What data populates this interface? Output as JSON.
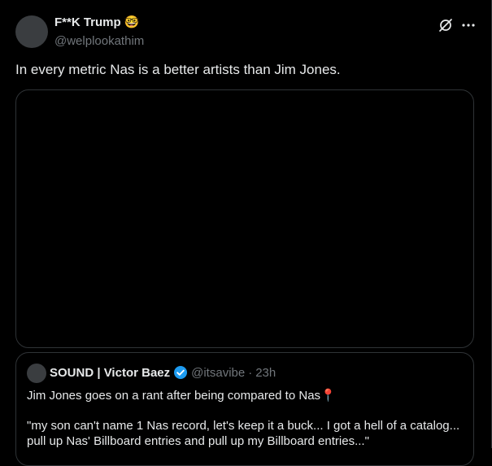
{
  "author": {
    "display_name": "F**K Trump",
    "name_emoji": "🤓",
    "handle": "@welplookathim"
  },
  "tweet": {
    "text": "In every metric Nas is a better artists than Jim Jones."
  },
  "icons": {
    "grok": "grok-icon",
    "more": "more-icon",
    "verified": "verified-badge-icon",
    "verified_color": "#1d9bf0"
  },
  "quote": {
    "display_name": "SOUND | Victor Baez",
    "handle": "@itsavibe",
    "separator": "·",
    "time": "23h",
    "line1": "Jim Jones goes on a rant after being compared to Nas📍",
    "line2": "\"my son can't name 1 Nas record, let's keep it a buck... I got a hell of a catalog...",
    "line3": "pull up Nas' Billboard entries and pull up my Billboard entries...\""
  }
}
